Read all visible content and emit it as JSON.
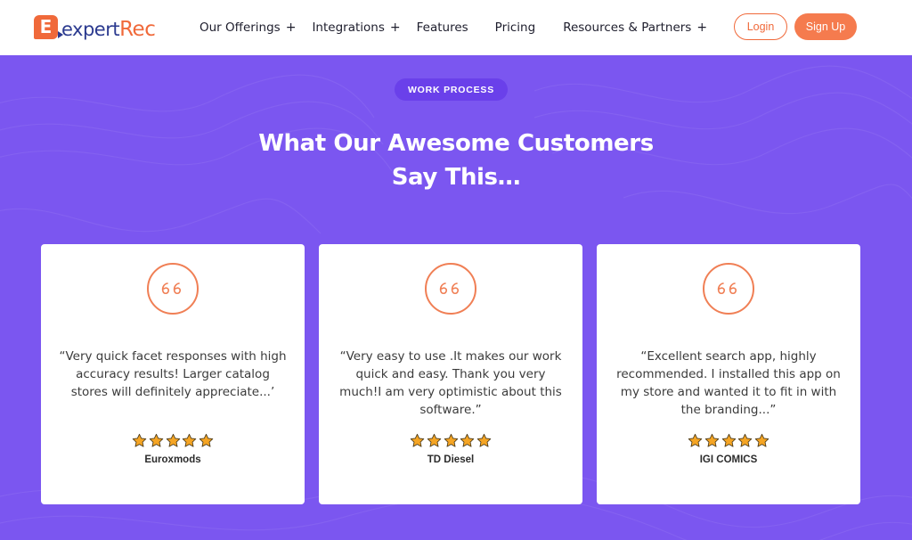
{
  "header": {
    "logo_prefix": "expert",
    "logo_suffix": "Rec",
    "logo_mark_letter": "E",
    "nav": [
      {
        "label": "Our Offerings",
        "has_plus": true
      },
      {
        "label": "Integrations",
        "has_plus": true
      },
      {
        "label": "Features",
        "has_plus": false
      },
      {
        "label": "Pricing",
        "has_plus": false
      },
      {
        "label": "Resources & Partners",
        "has_plus": true
      }
    ],
    "plus_symbol": "+",
    "login_label": "Login",
    "signup_label": "Sign Up"
  },
  "section": {
    "badge": "WORK PROCESS",
    "headline_line1": "What Our Awesome Customers",
    "headline_line2": "Say This…"
  },
  "testimonials": [
    {
      "quote": "“Very quick facet responses with high accuracy results! Larger catalog stores will definitely appreciate...’",
      "rating": 5,
      "author": "Euroxmods"
    },
    {
      "quote": "“Very easy to use .It makes our work quick and easy. Thank you very much!I am very optimistic about this software.”",
      "rating": 5,
      "author": "TD Diesel"
    },
    {
      "quote": "“Excellent search app, highly recommended. I installed this app on my store and wanted it to fit in with the branding...”",
      "rating": 5,
      "author": "IGI COMICS"
    }
  ],
  "icons": {
    "quote": "quote-icon",
    "star": "star-icon"
  },
  "colors": {
    "brand_orange": "#f0693a",
    "brand_navy": "#2b3a8f",
    "section_purple": "#7b56f0",
    "badge_purple": "#6a40ea",
    "star_fill": "#f5a524"
  }
}
